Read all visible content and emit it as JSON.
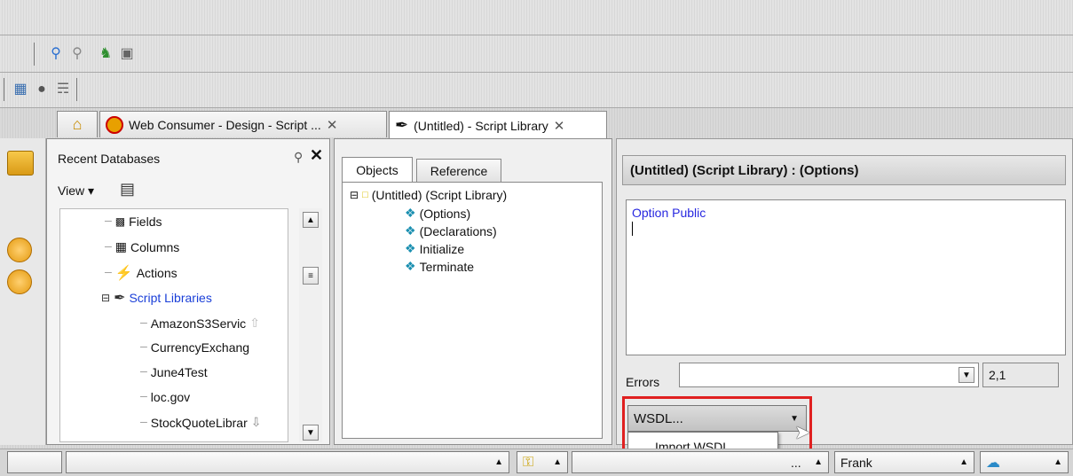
{
  "toolbars": {
    "row1_icons": [
      "search-icon",
      "search-alt-icon",
      "add-users-icon",
      "database-icon"
    ],
    "row2_icons": [
      "grid-icon",
      "globe-icon",
      "connect-icon"
    ]
  },
  "tabs": [
    {
      "label": "",
      "icon": "home-icon"
    },
    {
      "label": "Web Consumer - Design - Script ...",
      "icon": "app-logo-icon"
    },
    {
      "label": "(Untitled) - Script Library",
      "icon": "script-library-icon"
    }
  ],
  "nav_panel": {
    "title": "Recent Databases",
    "view_label": "View ▾",
    "tree": [
      {
        "label": "Fields",
        "icon": "fields-icon"
      },
      {
        "label": "Columns",
        "icon": "columns-icon"
      },
      {
        "label": "Actions",
        "icon": "actions-icon"
      },
      {
        "label": "Script Libraries",
        "icon": "script-libraries-icon"
      },
      {
        "label": "AmazonS3Servic",
        "icon": ""
      },
      {
        "label": "CurrencyExchang",
        "icon": ""
      },
      {
        "label": "June4Test",
        "icon": ""
      },
      {
        "label": "loc.gov",
        "icon": ""
      },
      {
        "label": "StockQuoteLibrar",
        "icon": ""
      }
    ]
  },
  "objects_panel": {
    "tabs": [
      "Objects",
      "Reference"
    ],
    "root": "(Untitled) (Script Library)",
    "children": [
      "(Options)",
      "(Declarations)",
      "Initialize",
      "Terminate"
    ]
  },
  "editor": {
    "header": "(Untitled) (Script Library) : (Options)",
    "code": "Option Public",
    "errors_label": "Errors",
    "errors_value": "",
    "position": "2,1",
    "wsdl_label": "WSDL...",
    "menu_item": "Import WSDL",
    "highlight_color": "#e02020"
  },
  "status_bar": {
    "user": "Frank",
    "location": "..."
  }
}
